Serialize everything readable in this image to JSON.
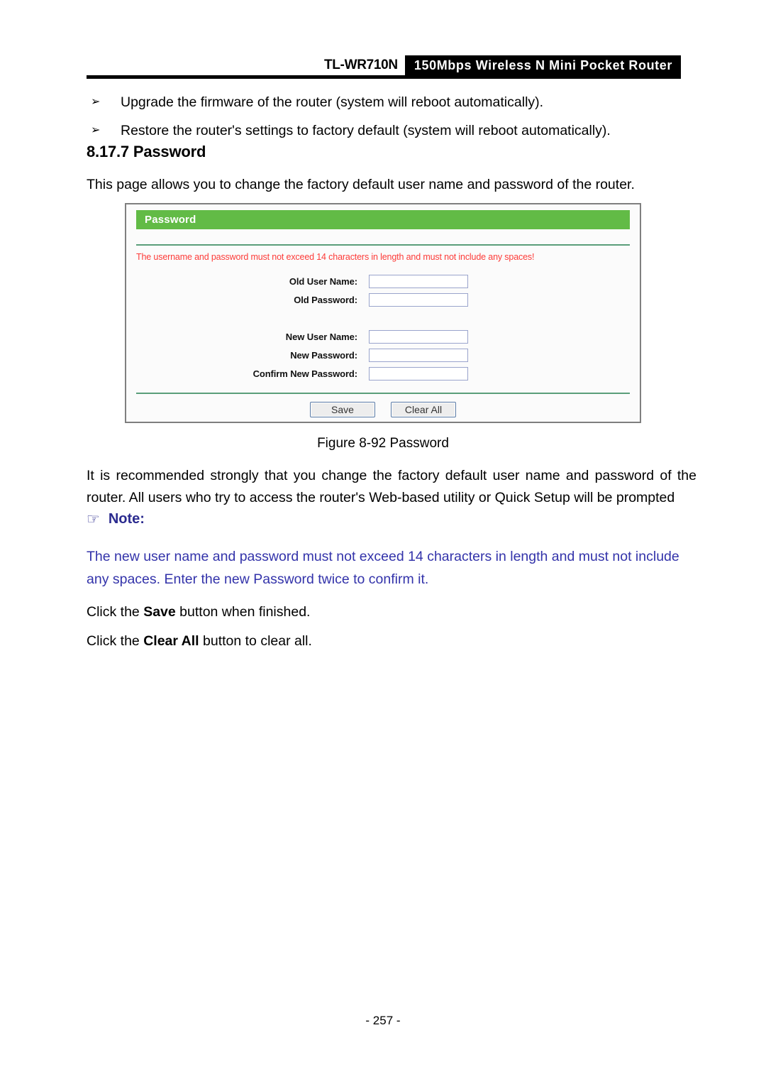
{
  "header": {
    "model": "TL-WR710N",
    "tagline": "150Mbps Wireless N Mini Pocket Router"
  },
  "bullets": [
    {
      "marker": "➢",
      "text": "Upgrade the firmware of the router (system will reboot automatically)."
    },
    {
      "marker": "➢",
      "text": "Restore the router's settings to factory default (system will reboot automatically)."
    }
  ],
  "section": {
    "heading": "8.17.7 Password",
    "intro": "This page allows you to change the factory default user name and password of the router."
  },
  "screenshot": {
    "panel_title": "Password",
    "warning": "The username and password must not exceed 14 characters in length and must not include any spaces!",
    "fields": [
      {
        "label": "Old User Name:",
        "value": "",
        "placeholder": ""
      },
      {
        "label": "Old Password:",
        "value": "",
        "placeholder": ""
      },
      {
        "label": "New User Name:",
        "value": "",
        "placeholder": ""
      },
      {
        "label": "New Password:",
        "value": "",
        "placeholder": ""
      },
      {
        "label": "Confirm New Password:",
        "value": "",
        "placeholder": ""
      }
    ],
    "buttons": {
      "save": "Save",
      "clear_all": "Clear All"
    },
    "colors": {
      "title_bar": "#62bb46",
      "warning_text": "#fd3b38",
      "divider": "#5a9e7a",
      "input_border": "#9aa4cc"
    }
  },
  "figure": {
    "caption": "Figure 8-92 Password"
  },
  "body": {
    "paragraph": "It is recommended strongly that you change the factory default user name and password of the router. All users who try to access the router's Web-based utility or Quick Setup will be prompted"
  },
  "note": {
    "icon": "☞",
    "label": "Note:",
    "text": "The new user name and password must not exceed 14 characters in length and must not include any spaces. Enter the new Password twice to confirm it.",
    "color": "#3333aa"
  },
  "closing": {
    "line1_prefix": "Click the ",
    "line1_bold": "Save",
    "line1_suffix": " button when finished.",
    "line2_prefix": "Click the ",
    "line2_bold": "Clear All",
    "line2_suffix": " button to clear all."
  },
  "footer": {
    "page_number": "- 257 -"
  }
}
